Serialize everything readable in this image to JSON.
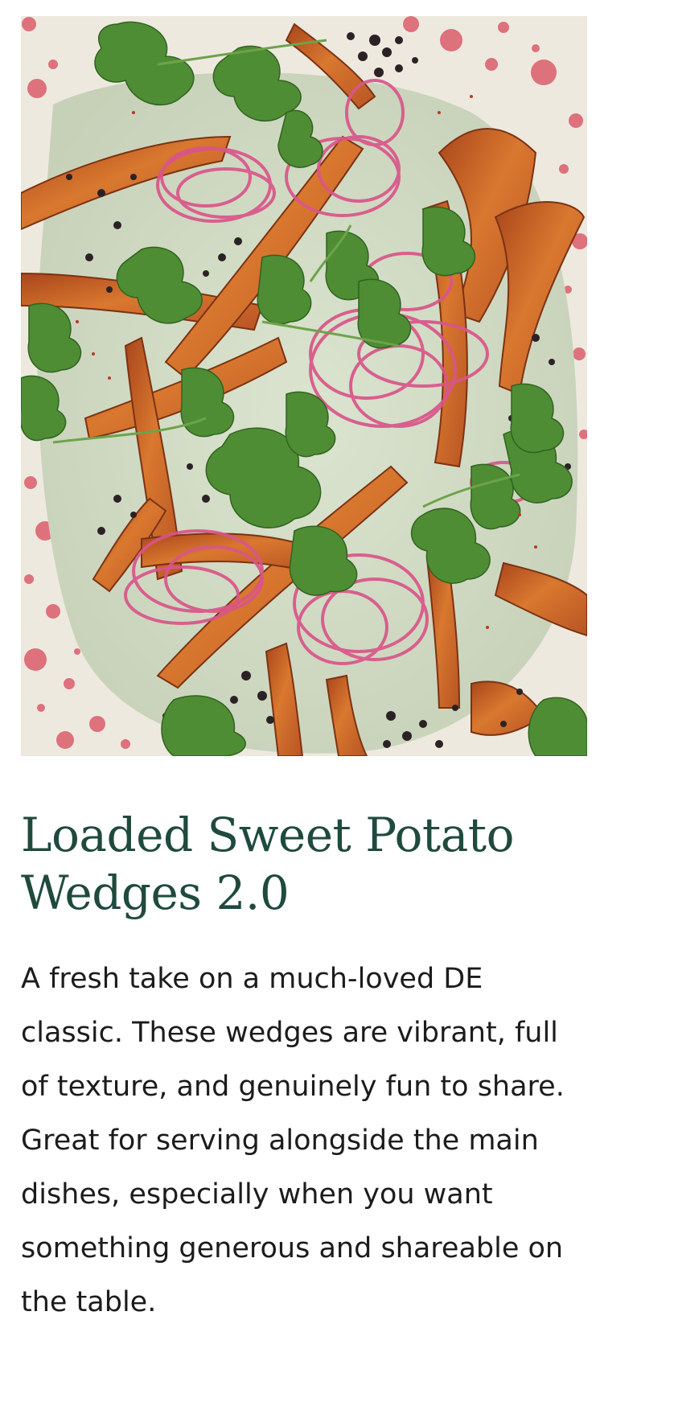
{
  "recipe": {
    "image_alt": "Loaded sweet potato wedges topped with pickled red onion, coriander and black lentils on a speckled plate",
    "title": "Loaded Sweet Potato Wedges 2.0",
    "description": "A fresh take on a much-loved DE classic. These wedges are vibrant, full of texture, and genuinely fun to share. Great for serving alongside the main dishes, especially when you want something generous and shareable on the table."
  },
  "colors": {
    "title": "#1f4a3d",
    "body_text": "#1c1c1c",
    "plate": "#ece7dc",
    "yoghurt": "#d6dfc9",
    "sweet_potato": "#c8662b",
    "onion": "#d9558a",
    "coriander": "#4f8d35",
    "lentil": "#2b2226",
    "splatter": "#d84a5c"
  }
}
